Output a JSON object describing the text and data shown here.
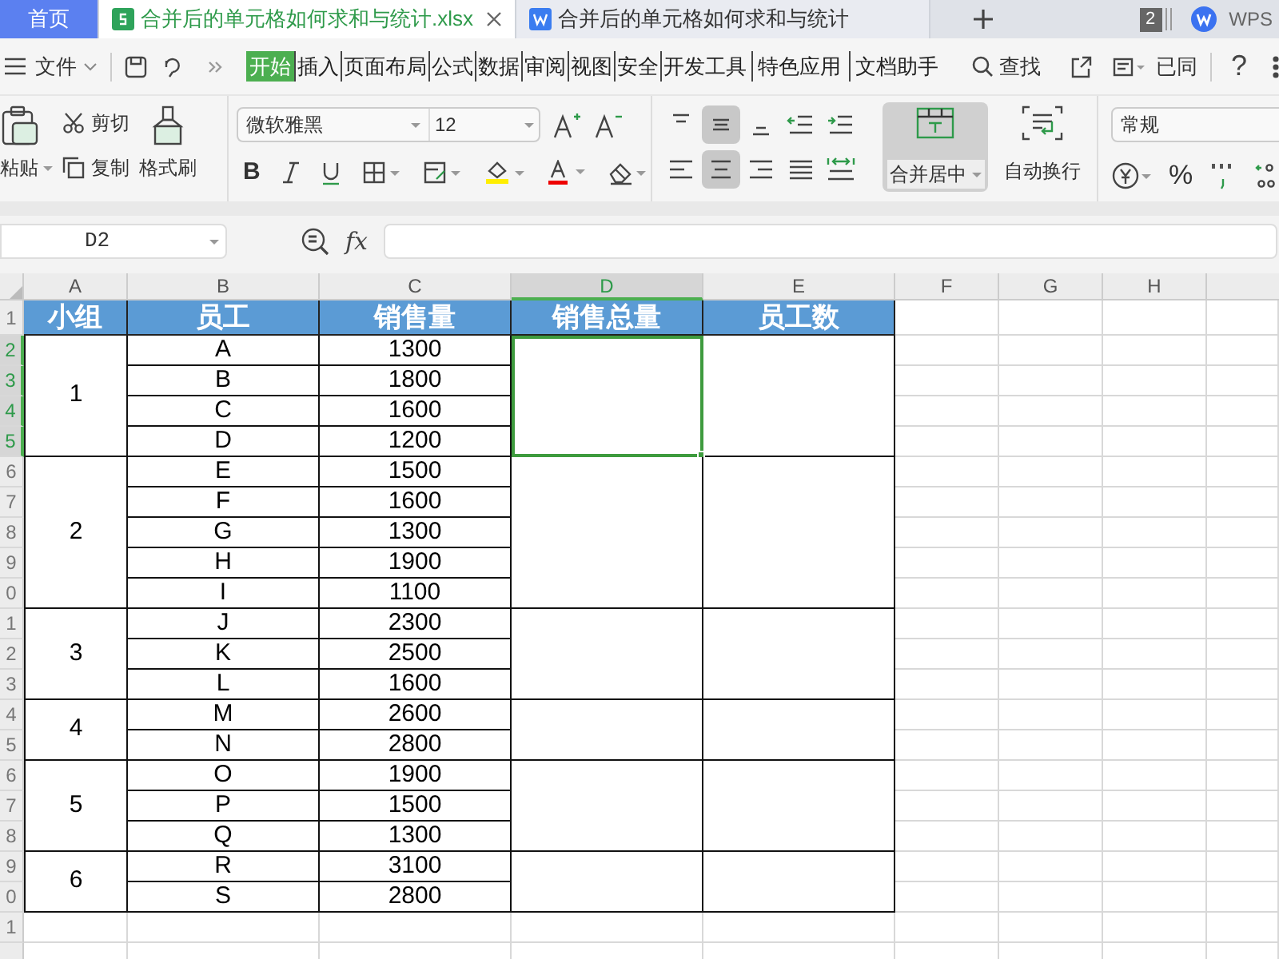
{
  "tabs": [
    {
      "label": "首页",
      "kind": "home",
      "selected": false
    },
    {
      "label": "合并后的单元格如何求和与统计.xlsx",
      "kind": "sheet",
      "selected": true
    },
    {
      "label": "合并后的单元格如何求和与统计",
      "kind": "doc",
      "selected": false
    }
  ],
  "window_count": "2",
  "app_label": "WPS",
  "menu": {
    "file": "文件",
    "items": [
      {
        "label": "开始",
        "selected": true
      },
      {
        "label": "插入",
        "selected": false
      },
      {
        "label": "页面布局",
        "selected": false
      },
      {
        "label": "公式",
        "selected": false
      },
      {
        "label": "数据",
        "selected": false
      },
      {
        "label": "审阅",
        "selected": false
      },
      {
        "label": "视图",
        "selected": false
      },
      {
        "label": "安全",
        "selected": false
      },
      {
        "label": "开发工具",
        "selected": false
      },
      {
        "label": "特色应用",
        "selected": false
      },
      {
        "label": "文档助手",
        "selected": false
      }
    ],
    "search": "查找",
    "sync": "已同"
  },
  "help": "?",
  "ribbon": {
    "bold": "B",
    "percent": "%",
    "paste": "粘贴",
    "cut": "剪切",
    "copy": "复制",
    "format_painter": "格式刷",
    "font": "微软雅黑",
    "font_size": "12",
    "merge": "合并居中",
    "wrap": "自动换行",
    "number_format": "常规"
  },
  "formula_bar": {
    "name_box": "D2",
    "fx": "fx"
  },
  "sheet": {
    "columns": [
      {
        "label": "A",
        "selected": false
      },
      {
        "label": "B",
        "selected": false
      },
      {
        "label": "C",
        "selected": false
      },
      {
        "label": "D",
        "selected": true
      },
      {
        "label": "E",
        "selected": false
      },
      {
        "label": "F",
        "selected": false
      },
      {
        "label": "G",
        "selected": false
      },
      {
        "label": "H",
        "selected": false
      }
    ],
    "row_headers": [
      {
        "label": "1",
        "selected": false
      },
      {
        "label": "2",
        "selected": true
      },
      {
        "label": "3",
        "selected": true
      },
      {
        "label": "4",
        "selected": true
      },
      {
        "label": "5",
        "selected": true
      },
      {
        "label": "6",
        "selected": false
      },
      {
        "label": "7",
        "selected": false
      },
      {
        "label": "8",
        "selected": false
      },
      {
        "label": "9",
        "selected": false
      },
      {
        "label": "0",
        "selected": false
      },
      {
        "label": "1",
        "selected": false
      },
      {
        "label": "2",
        "selected": false
      },
      {
        "label": "3",
        "selected": false
      },
      {
        "label": "4",
        "selected": false
      },
      {
        "label": "5",
        "selected": false
      },
      {
        "label": "6",
        "selected": false
      },
      {
        "label": "7",
        "selected": false
      },
      {
        "label": "8",
        "selected": false
      },
      {
        "label": "9",
        "selected": false
      },
      {
        "label": "0",
        "selected": false
      },
      {
        "label": "1",
        "selected": false
      }
    ],
    "table_columns": [
      "小组",
      "员工",
      "销售量",
      "销售总量",
      "员工数"
    ],
    "groups": [
      {
        "group": "1",
        "selected": true,
        "members": [
          {
            "employee": "A",
            "sales": "1300"
          },
          {
            "employee": "B",
            "sales": "1800"
          },
          {
            "employee": "C",
            "sales": "1600"
          },
          {
            "employee": "D",
            "sales": "1200"
          }
        ]
      },
      {
        "group": "2",
        "selected": false,
        "members": [
          {
            "employee": "E",
            "sales": "1500"
          },
          {
            "employee": "F",
            "sales": "1600"
          },
          {
            "employee": "G",
            "sales": "1300"
          },
          {
            "employee": "H",
            "sales": "1900"
          },
          {
            "employee": "I",
            "sales": "1100"
          }
        ]
      },
      {
        "group": "3",
        "selected": false,
        "members": [
          {
            "employee": "J",
            "sales": "2300"
          },
          {
            "employee": "K",
            "sales": "2500"
          },
          {
            "employee": "L",
            "sales": "1600"
          }
        ]
      },
      {
        "group": "4",
        "selected": false,
        "members": [
          {
            "employee": "M",
            "sales": "2600"
          },
          {
            "employee": "N",
            "sales": "2800"
          }
        ]
      },
      {
        "group": "5",
        "selected": false,
        "members": [
          {
            "employee": "O",
            "sales": "1900"
          },
          {
            "employee": "P",
            "sales": "1500"
          },
          {
            "employee": "Q",
            "sales": "1300"
          }
        ]
      },
      {
        "group": "6",
        "selected": false,
        "members": [
          {
            "employee": "R",
            "sales": "3100"
          },
          {
            "employee": "S",
            "sales": "2800"
          }
        ]
      }
    ]
  }
}
